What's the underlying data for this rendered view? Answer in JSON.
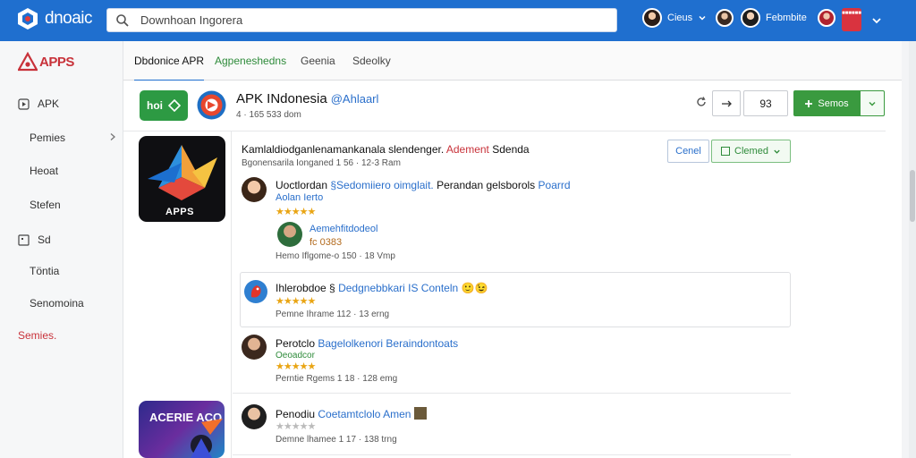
{
  "topbar": {
    "brand": "dnoaic",
    "search_placeholder": "Downhoan Ingorera",
    "user1_label": "Cieus",
    "user2_label": "Febmbite",
    "badge_text": "■■■■■■"
  },
  "sidebar": {
    "logo_text": "APPS",
    "items": [
      {
        "label": "APK",
        "icon": "play-box-icon"
      },
      {
        "label": "Pemies"
      },
      {
        "label": "Heoat"
      },
      {
        "label": "Stefen"
      },
      {
        "label": "Sd",
        "icon": "square-icon"
      },
      {
        "label": "Töntia"
      },
      {
        "label": "Senomoina"
      },
      {
        "label": "Semies."
      }
    ]
  },
  "tabs": [
    "Dbdonice APR",
    "Agpeneshedns",
    "Geenia",
    "Sdeolky"
  ],
  "app": {
    "badge_text": "hoi",
    "title": "APK INdonesia",
    "handle": "@Ahlaarl",
    "subtitle": "4 · 165 533 dom",
    "count_button": "93",
    "primary_button": "Semos",
    "apps_label": "APPS",
    "promo_text": "ACERIE ACO"
  },
  "headline": {
    "text": "Kamlaldiodganlenamankanala slendenger.",
    "red": "Adement",
    "tail": "Sdenda",
    "sub": "Bgonensarila Ionganed 1 56 · 12-3 Ram",
    "outline_button": "Cenel",
    "claimed_button": "Clemed"
  },
  "reviews": [
    {
      "name": "Uoctlordan",
      "title": "§Sedomiiero oimglait.",
      "rest": "Perandan gelsborols",
      "rest_blue": "Poarrd",
      "tag": "Aolan Ierto",
      "stars": "★★★★★"
    },
    {
      "name": "Aemehfitdodeol",
      "tag": "fc 0383",
      "meta": "Hemo Iflgome-o 150 · 18 Vmp"
    },
    {
      "name": "Ihlerobdoe §",
      "blue": "Dedgnebbkari IS Conteln",
      "stars": "★★★★★",
      "meta": "Pemne Ihrame 112 · 13 erng"
    },
    {
      "name": "Perotclo",
      "blue": "Bagelolkenori Beraindontoats",
      "tag": "Oeoadcor",
      "stars": "★★★★★",
      "meta": "Perntie Rgems 1 18 · 128 emg"
    },
    {
      "name": "Penodiu",
      "blue": "Coetamtclolo Amen",
      "stars": "★★★★★",
      "meta": "Demne lhamee 1 17 · 138 trng"
    }
  ]
}
